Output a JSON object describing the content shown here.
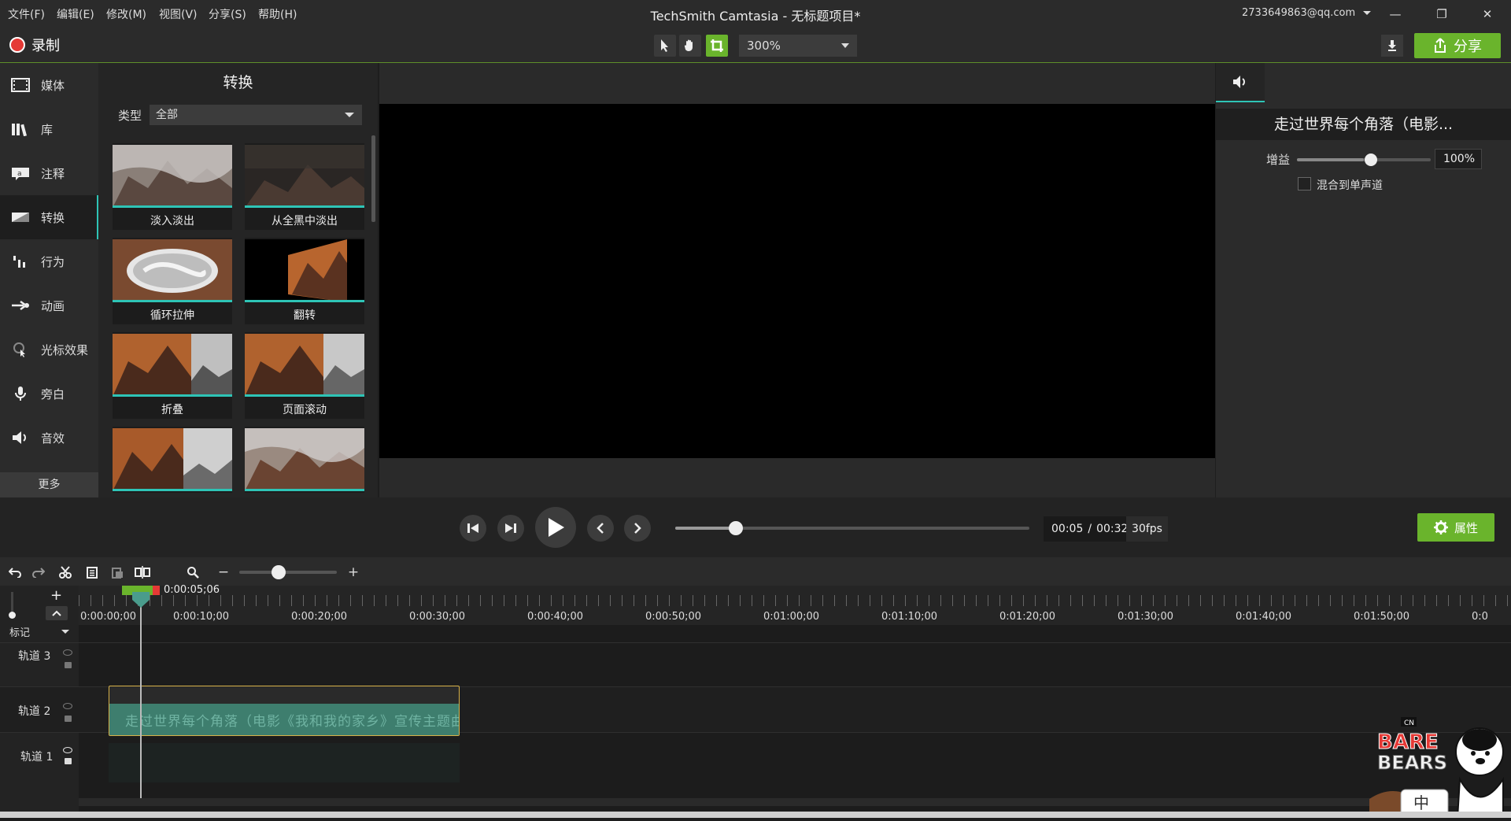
{
  "menu": [
    "文件(F)",
    "编辑(E)",
    "修改(M)",
    "视图(V)",
    "分享(S)",
    "帮助(H)"
  ],
  "app_title": "TechSmith Camtasia - 无标题项目*",
  "account": "2733649863@qq.com",
  "window_controls": {
    "minimize": "—",
    "maximize": "❐",
    "close": "✕"
  },
  "toolbar": {
    "record_label": "录制",
    "zoom": "300%",
    "share_label": "分享",
    "tools": [
      "pointer-icon",
      "hand-icon",
      "crop-icon"
    ],
    "accent": "#6ab42c"
  },
  "sidebar": {
    "items": [
      {
        "label": "媒体",
        "icon": "film-icon"
      },
      {
        "label": "库",
        "icon": "library-icon"
      },
      {
        "label": "注释",
        "icon": "annotation-icon"
      },
      {
        "label": "转换",
        "icon": "transition-icon"
      },
      {
        "label": "行为",
        "icon": "behavior-icon"
      },
      {
        "label": "动画",
        "icon": "animation-icon"
      },
      {
        "label": "光标效果",
        "icon": "cursor-icon"
      },
      {
        "label": "旁白",
        "icon": "microphone-icon"
      },
      {
        "label": "音效",
        "icon": "speaker-icon"
      }
    ],
    "active_index": 3,
    "more_label": "更多"
  },
  "transitions": {
    "title": "转换",
    "type_label": "类型",
    "type_value": "全部",
    "items": [
      "淡入淡出",
      "从全黑中淡出",
      "循环拉伸",
      "翻转",
      "折叠",
      "页面滚动",
      "",
      ""
    ]
  },
  "properties": {
    "title": "走过世界每个角落（电影...",
    "gain_label": "增益",
    "gain_value": "100%",
    "gain_level": 0.5,
    "mono_label": "混合到单声道",
    "mono_checked": false
  },
  "playback": {
    "current": "00:05",
    "separator": "/",
    "total": "00:32",
    "fps": "30fps",
    "progress": 0.16,
    "props_button": "属性"
  },
  "timeline": {
    "playhead_time": "0:00:05;06",
    "ticks": [
      "0:00:00;00",
      "0:00:10;00",
      "0:00:20;00",
      "0:00:30;00",
      "0:00:40;00",
      "0:00:50;00",
      "0:01:00;00",
      "0:01:10;00",
      "0:01:20;00",
      "0:01:30;00",
      "0:01:40;00",
      "0:01:50;00",
      "0:0"
    ],
    "zoom_level": 0.4,
    "marker_label": "标记",
    "tracks": [
      "轨道 3",
      "轨道 2",
      "轨道 1"
    ],
    "audio_clip_text": "走过世界每个角落（电影《我和我的家乡》宣传主题曲）",
    "add_track": "+"
  },
  "watermark": {
    "brand": "We BARE BEARS",
    "network": "CN",
    "chip": "中"
  }
}
